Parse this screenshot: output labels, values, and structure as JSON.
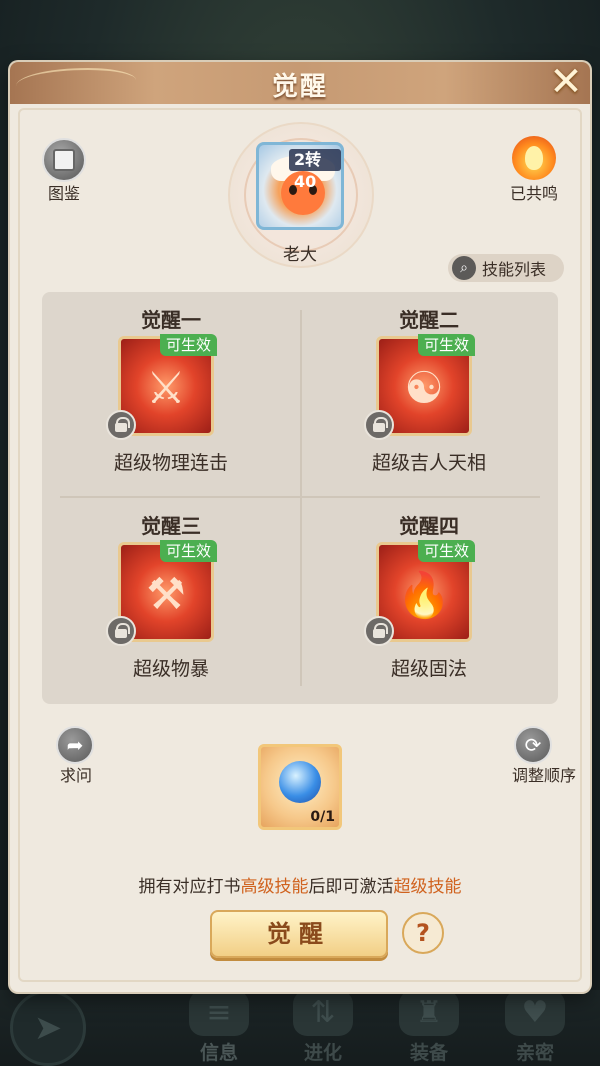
{
  "panel": {
    "title": "觉醒"
  },
  "top": {
    "atlas_label": "图鉴",
    "resonate_label": "已共鸣",
    "pet": {
      "tag": "2转40",
      "name": "老大"
    },
    "skill_list_label": "技能列表"
  },
  "awakenings": [
    {
      "title": "觉醒一",
      "badge": "可生效",
      "skill": "超级物理连击",
      "icon": "slash-combo-icon",
      "symbol": "⚔"
    },
    {
      "title": "觉醒二",
      "badge": "可生效",
      "skill": "超级吉人天相",
      "icon": "lucky-figure-icon",
      "symbol": "☯"
    },
    {
      "title": "觉醒三",
      "badge": "可生效",
      "skill": "超级物暴",
      "icon": "axe-crit-icon",
      "symbol": "⚒"
    },
    {
      "title": "觉醒四",
      "badge": "可生效",
      "skill": "超级固法",
      "icon": "fire-shield-icon",
      "symbol": "🔥"
    }
  ],
  "bottom": {
    "ask_label": "求问",
    "order_label": "调整顺序",
    "item_count": "0/1",
    "hint_parts": [
      "拥有对应打书",
      "高级技能",
      "后即可激活",
      "超级技能"
    ],
    "awaken_button": "觉醒",
    "help_symbol": "?"
  },
  "nav": [
    {
      "label": "",
      "icon": "back-arrow-icon"
    },
    {
      "label": "信息",
      "icon": "scroll-icon"
    },
    {
      "label": "进化",
      "icon": "evolve-icon"
    },
    {
      "label": "装备",
      "icon": "armor-icon"
    },
    {
      "label": "亲密",
      "icon": "heart-icon"
    }
  ],
  "colors": {
    "highlight": "#d0621e",
    "badge_green": "#4caf50",
    "header": "#c69a73"
  }
}
